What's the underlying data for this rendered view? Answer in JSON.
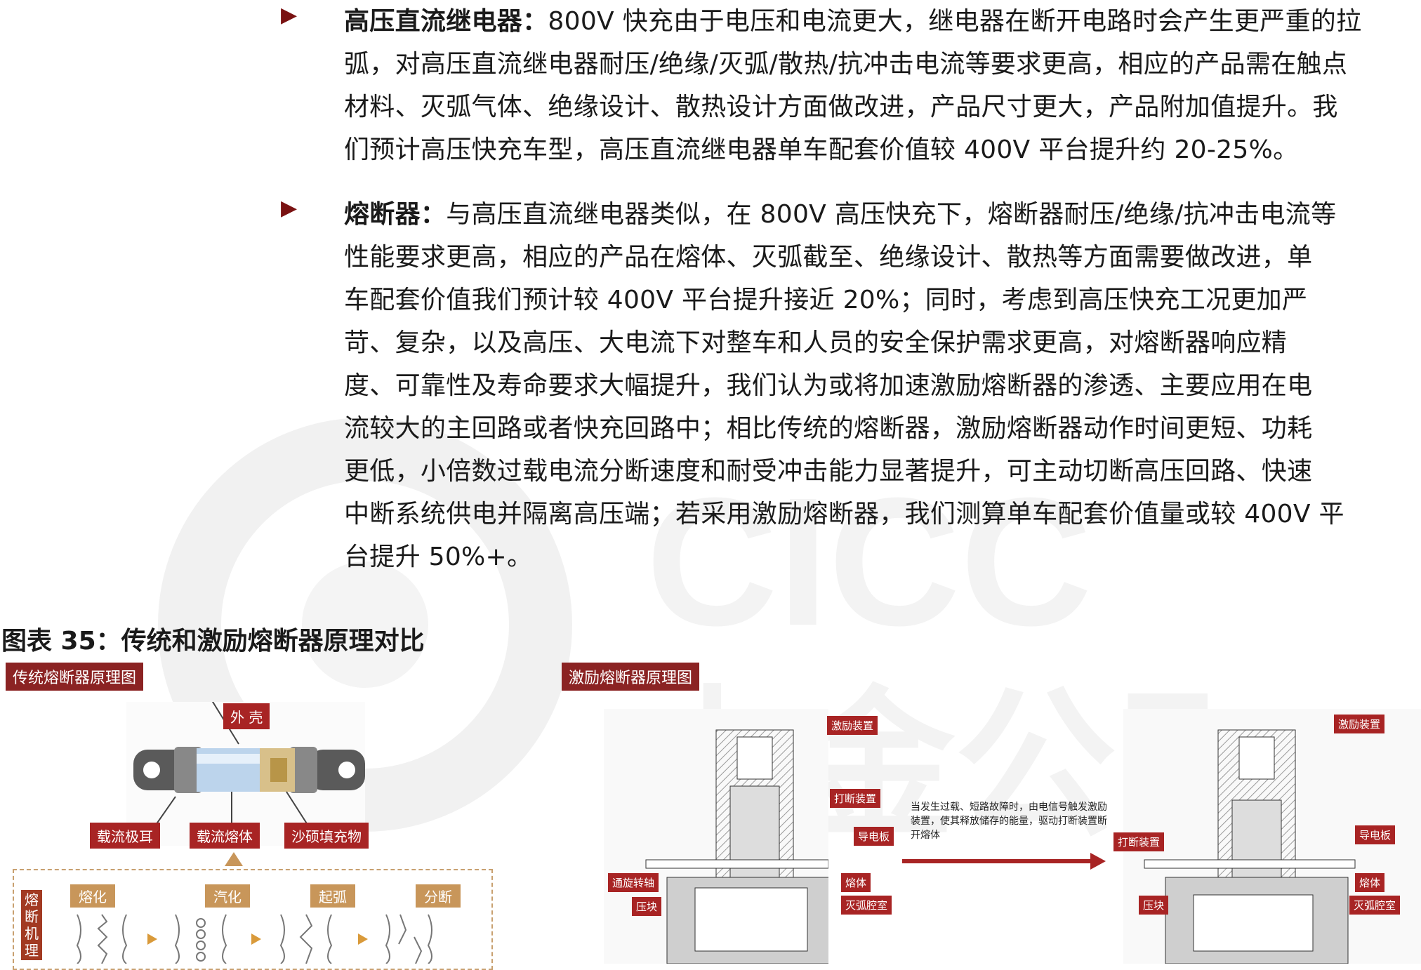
{
  "bullets": [
    {
      "title": "高压直流继电器：",
      "lines": [
        "800V 快充由于电压和电流更大，继电器在断开电路时会产生更严重的拉",
        "弧，对高压直流继电器耐压/绝缘/灭弧/散热/抗冲击电流等要求更高，相应的产品需在触点",
        "材料、灭弧气体、绝缘设计、散热设计方面做改进，产品尺寸更大，产品附加值提升。我",
        "们预计高压快充车型，高压直流继电器单车配套价值较 400V 平台提升约 20-25%。"
      ]
    },
    {
      "title": "熔断器：",
      "lines": [
        "与高压直流继电器类似，在 800V 高压快充下，熔断器耐压/绝缘/抗冲击电流等",
        "性能要求更高，相应的产品在熔体、灭弧截至、绝缘设计、散热等方面需要做改进，单",
        "车配套价值我们预计较 400V 平台提升接近 20%；同时，考虑到高压快充工况更加严",
        "苛、复杂，以及高压、大电流下对整车和人员的安全保护需求更高，对熔断器响应精",
        "度、可靠性及寿命要求大幅提升，我们认为或将加速激励熔断器的渗透、主要应用在电",
        "流较大的主回路或者快充回路中；相比传统的熔断器，激励熔断器动作时间更短、功耗",
        "更低，小倍数过载电流分断速度和耐受冲击能力显著提升，可主动切断高压回路、快速",
        "中断系统供电并隔离高压端；若采用激励熔断器，我们测算单车配套价值量或较 400V 平",
        "台提升 50%+。"
      ]
    }
  ],
  "figure": {
    "title": "图表 35：传统和激励熔断器原理对比",
    "left_panel": {
      "tag": "传统熔断器原理图",
      "callouts": {
        "shell": "外 壳",
        "ear": "载流极耳",
        "melt": "载流熔体",
        "sand": "沙硕填充物"
      },
      "side_label": "熔断机理",
      "steps": [
        "熔化",
        "汽化",
        "起弧",
        "分断"
      ]
    },
    "right_panel": {
      "tag": "激励熔断器原理图",
      "left_labels": {
        "excite": "激励装置",
        "break": "打断装置",
        "plate": "导电板",
        "rotate": "通旋转轴",
        "melt": "熔体",
        "press": "压块",
        "arc": "灭弧腔室"
      },
      "right_labels": {
        "excite": "激励装置",
        "break": "打断装置",
        "plate": "导电板",
        "press": "压块",
        "melt": "熔体",
        "arc": "灭弧腔室"
      },
      "note": "当发生过载、短路故障时，由电信号触发激励装置，使其释放储存的能量，驱动打断装置断开熔体"
    },
    "watermark_text": "中金公司"
  },
  "colors": {
    "accent": "#8b2323",
    "arrow": "#a82424",
    "step": "#c8965a"
  }
}
